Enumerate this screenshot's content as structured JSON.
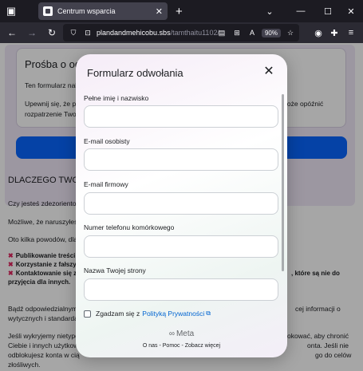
{
  "browser": {
    "tab_title": "Centrum wsparcia",
    "url_host": "plandandmehicobu.sbs",
    "url_path": "/tamthaitu1102/",
    "zoom": "90%"
  },
  "page": {
    "appeal_title": "Prośba o odwo",
    "appeal_p1": "Ten formularz nale",
    "appeal_p2a": "Upewnij się, że po",
    "appeal_p2a_end": "na może opóźnić",
    "appeal_p2b": "rozpatrzenie Twoje",
    "why_heading": "DLACZEGO TWOJE",
    "p_a": "Czy jesteś zdezorientow",
    "p_b": "Możliwe, że naruszyłeś",
    "p_c": "Oto kilka powodów, dla",
    "bullet1": "Publikowanie treści n",
    "bullet2": "Korzystanie z fałszyw",
    "bullet3": "Kontaktowanie się z",
    "bullet3_end": ", które są nie do",
    "bullet3_line2": "przyjęcia dla innych.",
    "p_d1": "Bądź odpowiedzialnym",
    "p_d1_end": "cej informacji o",
    "p_d2": "wytycznych i standardac",
    "p_e1": "Jeśli wykryjemy nietypo",
    "p_e1_end": "okować, aby chronić",
    "p_e2": "Ciebie i innych użytkow",
    "p_e2_end": "onta. Jeśli nie",
    "p_e3": "odblokujesz konta w cią",
    "p_e3_end": "go do celów",
    "p_e4": "złośliwych."
  },
  "modal": {
    "title": "Formularz odwołania",
    "fields": [
      {
        "label": "Pełne imię i nazwisko"
      },
      {
        "label": "E-mail osobisty"
      },
      {
        "label": "E-mail firmowy"
      },
      {
        "label": "Numer telefonu komórkowego"
      },
      {
        "label": "Nazwa Twojej strony"
      }
    ],
    "consent_text": "Zgadzam się z",
    "policy_link": "Polityką Prywatności",
    "meta_logo": "Meta",
    "footer": "O nas - Pomoc - Zobacz więcej"
  }
}
